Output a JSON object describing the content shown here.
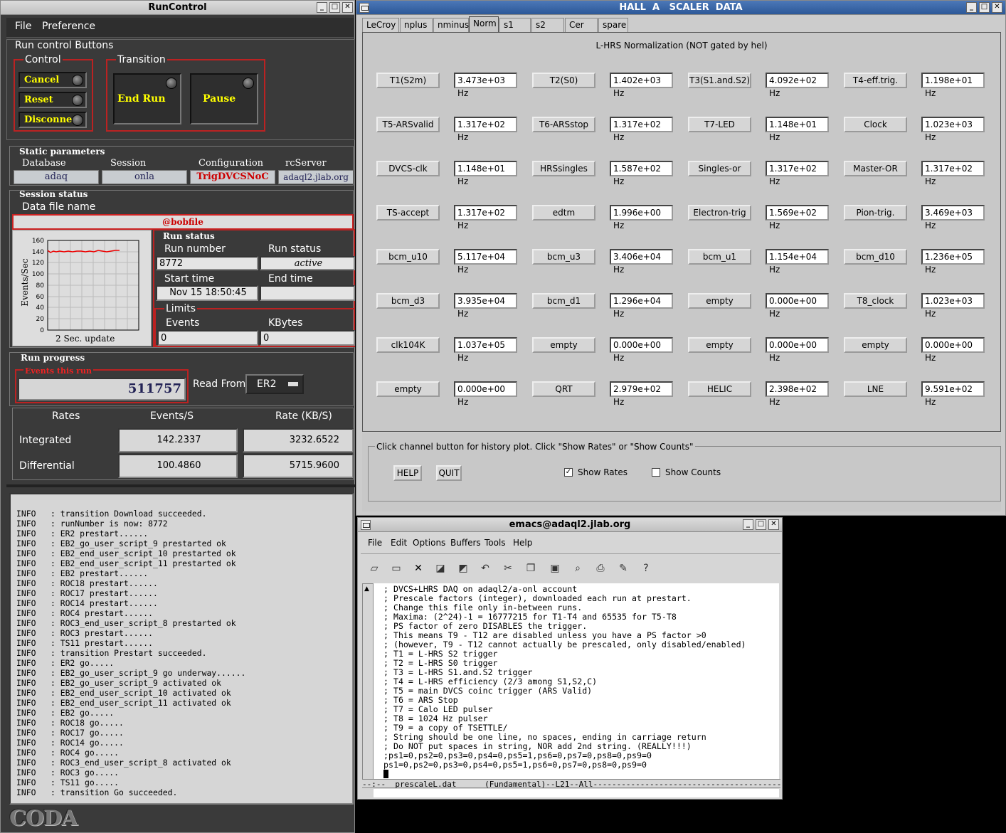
{
  "runcontrol": {
    "title": "RunControl",
    "menu": {
      "file": "File",
      "preference": "Preference"
    },
    "run_control_buttons_label": "Run control Buttons",
    "control_label": "Control",
    "transition_label": "Transition",
    "buttons": {
      "cancel": "Cancel",
      "reset": "Reset",
      "disconnect": "Disconnect",
      "end_run": "End Run",
      "pause": "Pause"
    },
    "static_params_label": "Static parameters",
    "static": {
      "database_label": "Database",
      "database": "adaq",
      "session_label": "Session",
      "session": "onla",
      "configuration_label": "Configuration",
      "configuration": "TrigDVCSNoC",
      "rcserver_label": "rcServer",
      "rcserver": "adaql2.jlab.org"
    },
    "session_status_label": "Session status",
    "data_file_label": "Data file name",
    "data_file": "@bobfile",
    "plot": {
      "ylabel": "Events/Sec",
      "xlabel": "2 Sec. update",
      "yticks": [
        "160",
        "140",
        "120",
        "100",
        "80",
        "60",
        "40",
        "20",
        "0"
      ]
    },
    "run_status_group": "Run status",
    "run_number_label": "Run number",
    "run_number": "8772",
    "run_status_label": "Run status",
    "run_status": "active",
    "start_time_label": "Start time",
    "start_time": "Nov 15 18:50:45",
    "end_time_label": "End time",
    "end_time": "",
    "limits_label": "Limits",
    "events_label": "Events",
    "events_limit": "0",
    "kbytes_label": "KBytes",
    "kbytes_limit": "0",
    "run_progress_label": "Run progress",
    "events_this_run_label": "Events this run",
    "events_this_run": "511757",
    "read_from_label": "Read From:",
    "read_from": "ER2",
    "rates": {
      "rates_label": "Rates",
      "events_s_label": "Events/S",
      "rate_kbs_label": "Rate (KB/S)",
      "integrated_label": "Integrated",
      "integrated_events": "142.2337",
      "integrated_rate": "3232.6522",
      "differential_label": "Differential",
      "differential_events": "100.4860",
      "differential_rate": "5715.9600"
    },
    "log": [
      "INFO   : transition Download succeeded.",
      "INFO   : runNumber is now: 8772",
      "INFO   : ER2 prestart......",
      "INFO   : EB2_go_user_script_9 prestarted ok",
      "INFO   : EB2_end_user_script_10 prestarted ok",
      "INFO   : EB2_end_user_script_11 prestarted ok",
      "INFO   : EB2 prestart......",
      "INFO   : ROC18 prestart......",
      "INFO   : ROC17 prestart......",
      "INFO   : ROC14 prestart......",
      "INFO   : ROC4 prestart......",
      "INFO   : ROC3_end_user_script_8 prestarted ok",
      "INFO   : ROC3 prestart......",
      "INFO   : TS11 prestart......",
      "INFO   : transition Prestart succeeded.",
      "INFO   : ER2 go.....",
      "INFO   : EB2_go_user_script_9 go underway......",
      "INFO   : EB2_go_user_script_9 activated ok",
      "INFO   : EB2_end_user_script_10 activated ok",
      "INFO   : EB2_end_user_script_11 activated ok",
      "INFO   : EB2 go.....",
      "INFO   : ROC18 go.....",
      "INFO   : ROC17 go.....",
      "INFO   : ROC14 go.....",
      "INFO   : ROC4 go.....",
      "INFO   : ROC3_end_user_script_8 activated ok",
      "INFO   : ROC3 go.....",
      "INFO   : TS11 go.....",
      "INFO   : transition Go succeeded."
    ],
    "logo": "CODA"
  },
  "scaler": {
    "title": "HALL  A   SCALER  DATA",
    "tabs": [
      "LeCroy",
      "nplus",
      "nminus",
      "Norm",
      "s1",
      "s2",
      "Cer",
      "spare"
    ],
    "active_tab": "Norm",
    "heading": "L-HRS Normalization (NOT gated by hel)",
    "rows": [
      [
        [
          "T1(S2m)",
          "3.473e+03 Hz"
        ],
        [
          "T2(S0)",
          "1.402e+03 Hz"
        ],
        [
          "T3(S1.and.S2)",
          "4.092e+02 Hz"
        ],
        [
          "T4-eff.trig.",
          "1.198e+01 Hz"
        ]
      ],
      [
        [
          "T5-ARSvalid",
          "1.317e+02 Hz"
        ],
        [
          "T6-ARSstop",
          "1.317e+02 Hz"
        ],
        [
          "T7-LED",
          "1.148e+01 Hz"
        ],
        [
          "Clock",
          "1.023e+03 Hz"
        ]
      ],
      [
        [
          "DVCS-clk",
          "1.148e+01 Hz"
        ],
        [
          "HRSsingles",
          "1.587e+02 Hz"
        ],
        [
          "Singles-or",
          "1.317e+02 Hz"
        ],
        [
          "Master-OR",
          "1.317e+02 Hz"
        ]
      ],
      [
        [
          "TS-accept",
          "1.317e+02 Hz"
        ],
        [
          "edtm",
          "1.996e+00 Hz"
        ],
        [
          "Electron-trig",
          "1.569e+02 Hz"
        ],
        [
          "Pion-trig.",
          "3.469e+03 Hz"
        ]
      ],
      [
        [
          "bcm_u10",
          "5.117e+04 Hz"
        ],
        [
          "bcm_u3",
          "3.406e+04 Hz"
        ],
        [
          "bcm_u1",
          "1.154e+04 Hz"
        ],
        [
          "bcm_d10",
          "1.236e+05 Hz"
        ]
      ],
      [
        [
          "bcm_d3",
          "3.935e+04 Hz"
        ],
        [
          "bcm_d1",
          "1.296e+04 Hz"
        ],
        [
          "empty",
          "0.000e+00 Hz"
        ],
        [
          "T8_clock",
          "1.023e+03 Hz"
        ]
      ],
      [
        [
          "clk104K",
          "1.037e+05 Hz"
        ],
        [
          "empty",
          "0.000e+00 Hz"
        ],
        [
          "empty",
          "0.000e+00 Hz"
        ],
        [
          "empty",
          "0.000e+00 Hz"
        ]
      ],
      [
        [
          "empty",
          "0.000e+00 Hz"
        ],
        [
          "QRT",
          "2.979e+02 Hz"
        ],
        [
          "HELIC",
          "2.398e+02 Hz"
        ],
        [
          "LNE",
          "9.591e+02 Hz"
        ]
      ]
    ],
    "instructions": "Click channel button for history plot.  Click \"Show Rates\" or \"Show Counts\"",
    "help": "HELP",
    "quit": "QUIT",
    "show_rates": "Show Rates",
    "show_counts": "Show Counts",
    "show_rates_checked": true,
    "show_counts_checked": false
  },
  "emacs": {
    "title": "emacs@adaql2.jlab.org",
    "menu": [
      "File",
      "Edit",
      "Options",
      "Buffers",
      "Tools",
      "Help"
    ],
    "toolbar_icons": [
      "new-file-icon",
      "open-folder-icon",
      "close-icon",
      "save-icon",
      "save-as-icon",
      "undo-icon",
      "cut-icon",
      "copy-icon",
      "paste-icon",
      "search-icon",
      "print-icon",
      "preferences-icon",
      "help-icon"
    ],
    "lines": [
      "; DVCS+LHRS DAQ on adaql2/a-onl account",
      "; Prescale factors (integer), downloaded each run at prestart.",
      "; Change this file only in-between runs.",
      "; Maxima: (2^24)-1 = 16777215 for T1-T4 and 65535 for T5-T8",
      "; PS factor of zero DISABLES the trigger.",
      "; This means T9 - T12 are disabled unless you have a PS factor >0",
      "; (however, T9 - T12 cannot actually be prescaled, only disabled/enabled)",
      "; T1 = L-HRS S2 trigger",
      "; T2 = L-HRS S0 trigger",
      "; T3 = L-HRS S1.and.S2 trigger",
      "; T4 = L-HRS efficiency (2/3 among S1,S2,C)",
      "; T5 = main DVCS coinc trigger (ARS Valid)",
      "; T6 = ARS Stop",
      "; T7 = Calo LED pulser",
      "; T8 = 1024 Hz pulser",
      "; T9 = a copy of TSETTLE/",
      "; String should be one line, no spaces, ending in carriage return",
      "; Do NOT put spaces in string, NOR add 2nd string. (REALLY!!!)",
      ";ps1=0,ps2=0,ps3=0,ps4=0,ps5=1,ps6=0,ps7=0,ps8=0,ps9=0",
      "ps1=0,ps2=0,ps3=0,ps4=0,ps5=1,ps6=0,ps7=0,ps8=0,ps9=0"
    ],
    "modeline": "--:--  prescaleL.dat      (Fundamental)--L21--All------------------------------------------"
  }
}
